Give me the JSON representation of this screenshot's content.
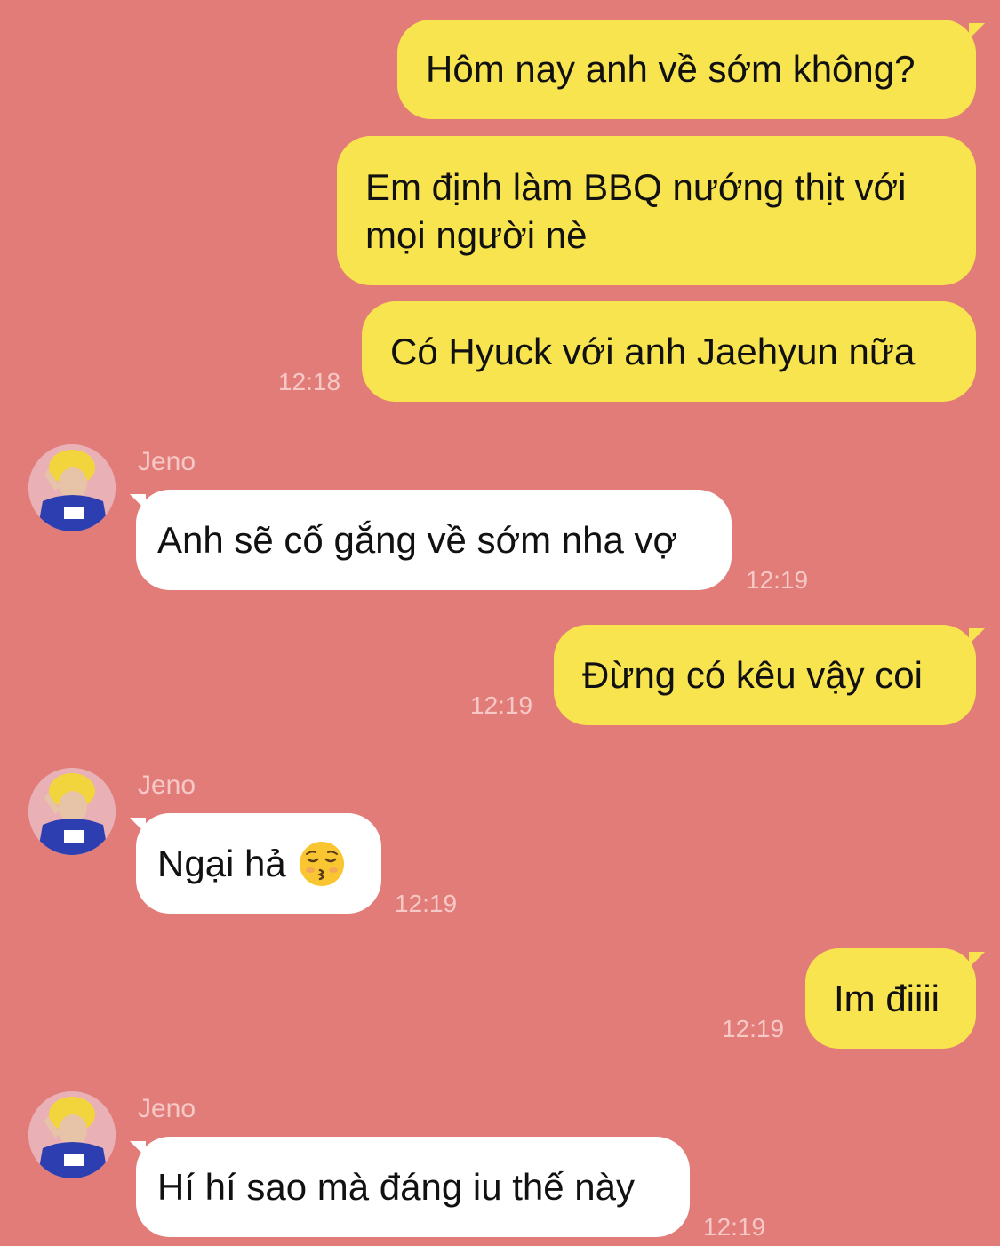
{
  "chat": {
    "contact_name": "Jeno",
    "messages": [
      {
        "text": "Hôm nay anh về sớm không?"
      },
      {
        "text_line1": "Em định làm BBQ nướng thịt với",
        "text_line2": "mọi người nè"
      },
      {
        "text": "Có Hyuck với anh Jaehyun nữa",
        "time": "12:18"
      },
      {
        "sender": "Jeno",
        "text": "Anh sẽ cố gắng về sớm nha vợ",
        "time": "12:19"
      },
      {
        "text": "Đừng có kêu vậy coi",
        "time": "12:19"
      },
      {
        "sender": "Jeno",
        "text": "Ngại hả",
        "emoji": "kissing-closed-eyes-emoji",
        "time": "12:19"
      },
      {
        "text": "Im điiii",
        "time": "12:19"
      },
      {
        "sender": "Jeno",
        "text": "Hí hí sao mà đáng iu thế này",
        "time": "12:19"
      }
    ]
  },
  "colors": {
    "background": "#e27c79",
    "outgoing_bubble": "#f8e44f",
    "incoming_bubble": "#ffffff",
    "meta_text": "#f6c8c6"
  }
}
